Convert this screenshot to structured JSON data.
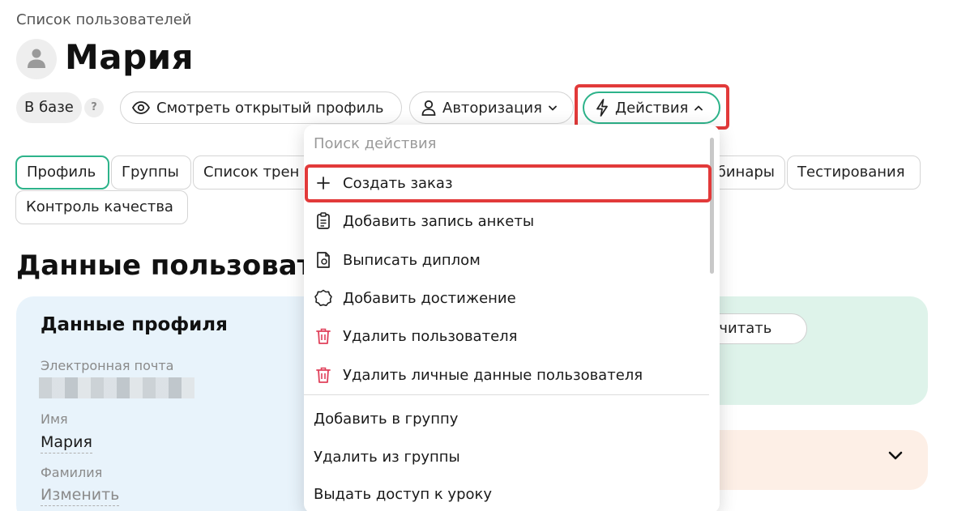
{
  "breadcrumb": "Список пользователей",
  "page_title": "Мария",
  "avatar_icon": "person-icon",
  "status": {
    "label": "В базе",
    "help": "?"
  },
  "header_buttons": {
    "view_profile": "Смотреть открытый профиль",
    "authorization": "Авторизация",
    "actions": "Действия"
  },
  "tabs": {
    "profile": "Профиль",
    "groups": "Группы",
    "trainings": "Список трен",
    "webinars": "бинары",
    "tests": "Тестирования",
    "quality": "Контроль качества"
  },
  "section_title": "Данные пользовател",
  "profile_card": {
    "title": "Данные профиля",
    "email_label": "Электронная почта",
    "name_label": "Имя",
    "name_value": "Мария",
    "surname_label": "Фамилия",
    "surname_value": "Изменить"
  },
  "recalc_button": "ресчитать",
  "actions_menu": {
    "search_placeholder": "Поиск действия",
    "items": [
      {
        "label": "Создать заказ",
        "icon": "plus-icon"
      },
      {
        "label": "Добавить запись анкеты",
        "icon": "clipboard-icon"
      },
      {
        "label": "Выписать диплом",
        "icon": "diploma-icon"
      },
      {
        "label": "Добавить достижение",
        "icon": "badge-icon"
      },
      {
        "label": "Удалить пользователя",
        "icon": "trash-icon"
      },
      {
        "label": "Удалить личные данные пользователя",
        "icon": "trash-icon"
      },
      {
        "label": "Добавить в группу"
      },
      {
        "label": "Удалить из группы"
      },
      {
        "label": "Выдать доступ к уроку"
      }
    ]
  },
  "colors": {
    "accent": "#2db38a",
    "highlight": "#e23a3a",
    "danger_icon": "#e0405a",
    "profile_card_bg": "#e8f3fb",
    "green_card_bg": "#def3ea",
    "peach_card_bg": "#fdefe6"
  }
}
